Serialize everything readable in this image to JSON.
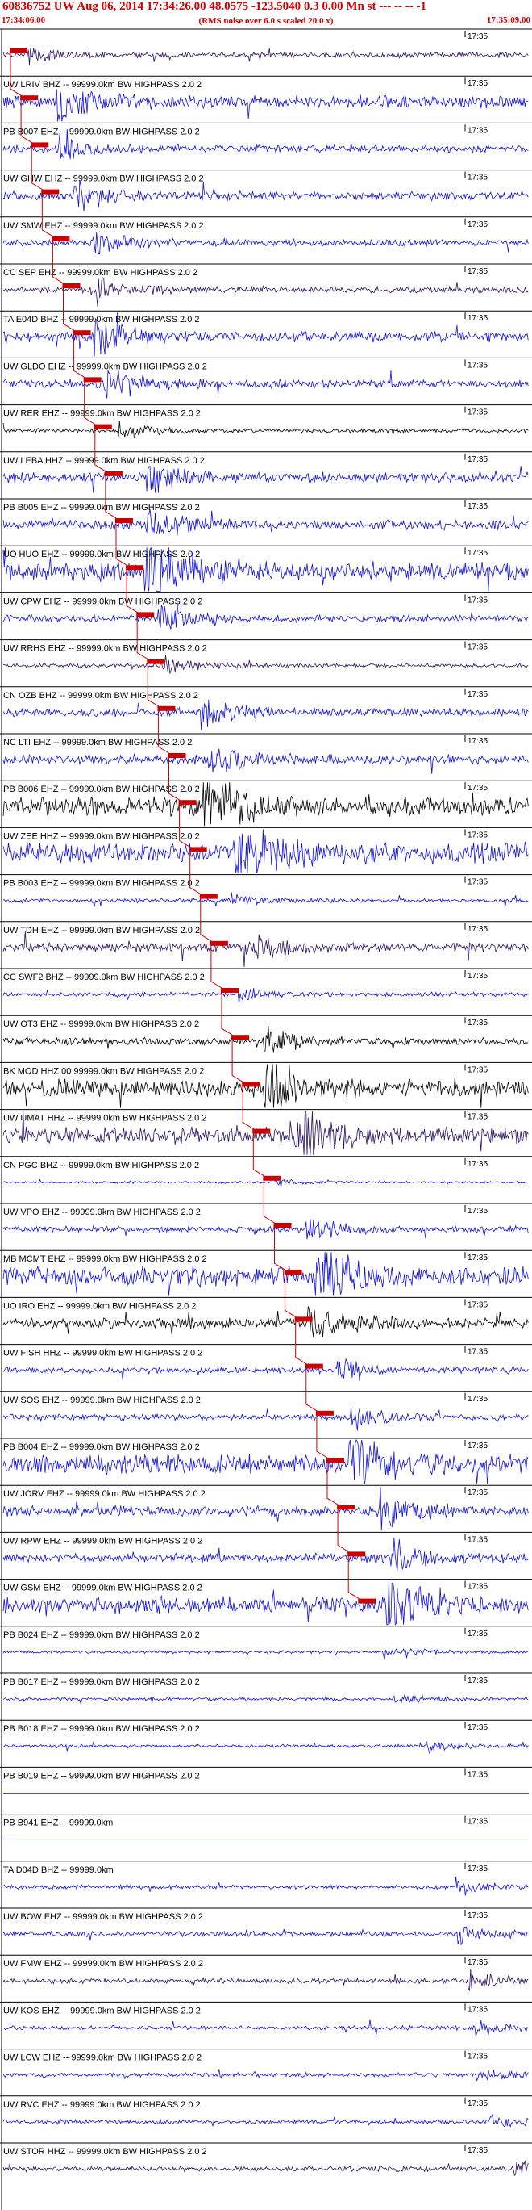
{
  "header": {
    "title": "60836752 UW Aug 06, 2014 17:34:26.00   48.0575 -123.5040  0.3 0.00 Mn st --- -- --  -1",
    "start_time": "17:34:06.00",
    "note": "(RMS noise over 6.0 s scaled 20.0 x)",
    "end_time": "17:35:09.00"
  },
  "colors": {
    "header": "#d40000",
    "pick": "#cc0000",
    "move_out": "#cc0000",
    "trace_blue": "#1010e0",
    "trace_dark": "#2a1060",
    "trace_black": "#000000"
  },
  "chart_data": {
    "type": "seismogram_record_section",
    "x_range": [
      "17:34:06.00",
      "17:35:09.00"
    ],
    "tick_label": "17:35",
    "traces": [
      {
        "label": "",
        "color": "dark",
        "amp": 0.25
      },
      {
        "label": "UW LRIV BHZ -- 99999.0km BW  HIGHPASS  2.0  2",
        "color": "blue",
        "amp": 0.6
      },
      {
        "label": "PB B007 EHZ -- 99999.0km BW  HIGHPASS  2.0  2",
        "color": "blue",
        "amp": 0.35
      },
      {
        "label": "UW GHW EHZ -- 99999.0km BW  HIGHPASS  2.0  2",
        "color": "blue",
        "amp": 0.4
      },
      {
        "label": "UW SMW EHZ -- 99999.0km BW  HIGHPASS  2.0  2",
        "color": "blue",
        "amp": 0.3
      },
      {
        "label": "CC SEP EHZ -- 99999.0km BW  HIGHPASS  2.0  2",
        "color": "dark",
        "amp": 0.3
      },
      {
        "label": "TA E04D BHZ -- 99999.0km BW  HIGHPASS  2.0  2",
        "color": "blue",
        "amp": 0.5
      },
      {
        "label": "UW GLDO EHZ -- 99999.0km BW  HIGHPASS  2.0  2",
        "color": "blue",
        "amp": 0.4
      },
      {
        "label": "UW RER EHZ -- 99999.0km BW  HIGHPASS  2.0  2",
        "color": "black",
        "amp": 0.2
      },
      {
        "label": "UW LEBA HHZ -- 99999.0km BW  HIGHPASS  2.0  2",
        "color": "blue",
        "amp": 0.5
      },
      {
        "label": "PB B005 EHZ -- 99999.0km BW  HIGHPASS  2.0  2",
        "color": "blue",
        "amp": 0.45
      },
      {
        "label": "UO HUO EHZ -- 99999.0km BW  HIGHPASS  2.0  2",
        "color": "blue",
        "amp": 0.9
      },
      {
        "label": "UW CPW EHZ -- 99999.0km BW  HIGHPASS  2.0  2",
        "color": "blue",
        "amp": 0.35
      },
      {
        "label": "UW RRHS EHZ -- 99999.0km BW  HIGHPASS  2.0  2",
        "color": "dark",
        "amp": 0.2
      },
      {
        "label": "CN OZB BHZ -- 99999.0km BW  HIGHPASS  2.0  2",
        "color": "blue",
        "amp": 0.4
      },
      {
        "label": "NC LTI EHZ -- 99999.0km BW  HIGHPASS  2.0  2",
        "color": "blue",
        "amp": 0.45
      },
      {
        "label": "PB B006 EHZ -- 99999.0km BW  HIGHPASS  2.0  2",
        "color": "black",
        "amp": 0.9
      },
      {
        "label": "UW ZEE HHZ -- 99999.0km BW  HIGHPASS  2.0  2",
        "color": "blue",
        "amp": 1.0
      },
      {
        "label": "PB B003 EHZ -- 99999.0km BW  HIGHPASS  2.0  2",
        "color": "blue",
        "amp": 0.2
      },
      {
        "label": "UW TDH EHZ -- 99999.0km BW  HIGHPASS  2.0  2",
        "color": "dark",
        "amp": 0.45
      },
      {
        "label": "CC SWF2 BHZ -- 99999.0km BW  HIGHPASS  2.0  2",
        "color": "blue",
        "amp": 0.2
      },
      {
        "label": "UW OT3 EHZ -- 99999.0km BW  HIGHPASS  2.0  2",
        "color": "black",
        "amp": 0.35
      },
      {
        "label": "BK MOD HHZ 00 99999.0km BW  HIGHPASS  2.0  2",
        "color": "black",
        "amp": 0.8
      },
      {
        "label": "UW UMAT HHZ -- 99999.0km BW  HIGHPASS  2.0  2",
        "color": "dark",
        "amp": 0.8
      },
      {
        "label": "CN PGC BHZ -- 99999.0km BW  HIGHPASS  2.0  2",
        "color": "blue",
        "amp": 0.1
      },
      {
        "label": "UW VPO EHZ -- 99999.0km BW  HIGHPASS  2.0  2",
        "color": "blue",
        "amp": 0.3
      },
      {
        "label": "MB MCMT EHZ -- 99999.0km BW  HIGHPASS  2.0  2",
        "color": "blue",
        "amp": 0.9
      },
      {
        "label": "UO IRO EHZ -- 99999.0km BW  HIGHPASS  2.0  2",
        "color": "black",
        "amp": 0.5
      },
      {
        "label": "UW FISH HHZ -- 99999.0km BW  HIGHPASS  2.0  2",
        "color": "blue",
        "amp": 0.3
      },
      {
        "label": "UW SOS EHZ -- 99999.0km BW  HIGHPASS  2.0  2",
        "color": "blue",
        "amp": 0.3
      },
      {
        "label": "PB B004 EHZ -- 99999.0km BW  HIGHPASS  2.0  2",
        "color": "blue",
        "amp": 0.9
      },
      {
        "label": "UW JORV EHZ -- 99999.0km BW  HIGHPASS  2.0  2",
        "color": "blue",
        "amp": 0.5
      },
      {
        "label": "UW RPW EHZ -- 99999.0km BW  HIGHPASS  2.0  2",
        "color": "blue",
        "amp": 0.45
      },
      {
        "label": "UW GSM EHZ -- 99999.0km BW  HIGHPASS  2.0  2",
        "color": "blue",
        "amp": 0.8
      },
      {
        "label": "PB B024 EHZ -- 99999.0km BW  HIGHPASS  2.0  2",
        "color": "blue",
        "amp": 0.15
      },
      {
        "label": "PB B017 EHZ -- 99999.0km BW  HIGHPASS  2.0  2",
        "color": "blue",
        "amp": 0.15
      },
      {
        "label": "PB B018 EHZ -- 99999.0km BW  HIGHPASS  2.0  2",
        "color": "blue",
        "amp": 0.15
      },
      {
        "label": "PB B019 EHZ -- 99999.0km BW  HIGHPASS  2.0  2",
        "color": "blue",
        "amp": 0.0
      },
      {
        "label": "PB B941 EHZ -- 99999.0km",
        "color": "blue",
        "amp": 0.0
      },
      {
        "label": "TA D04D BHZ -- 99999.0km",
        "color": "blue",
        "amp": 0.2
      },
      {
        "label": "UW BOW EHZ -- 99999.0km BW  HIGHPASS  2.0  2",
        "color": "blue",
        "amp": 0.25
      },
      {
        "label": "UW FMW EHZ -- 99999.0km BW  HIGHPASS  2.0  2",
        "color": "dark",
        "amp": 0.25
      },
      {
        "label": "UW KOS EHZ -- 99999.0km BW  HIGHPASS  2.0  2",
        "color": "blue",
        "amp": 0.2
      },
      {
        "label": "UW LCW EHZ -- 99999.0km BW  HIGHPASS  2.0  2",
        "color": "blue",
        "amp": 0.2
      },
      {
        "label": "UW RVC EHZ -- 99999.0km BW  HIGHPASS  2.0  2",
        "color": "blue",
        "amp": 0.2
      },
      {
        "label": "UW STOR HHZ -- 99999.0km BW  HIGHPASS  2.0  2",
        "color": "dark",
        "amp": 0.25
      }
    ]
  }
}
